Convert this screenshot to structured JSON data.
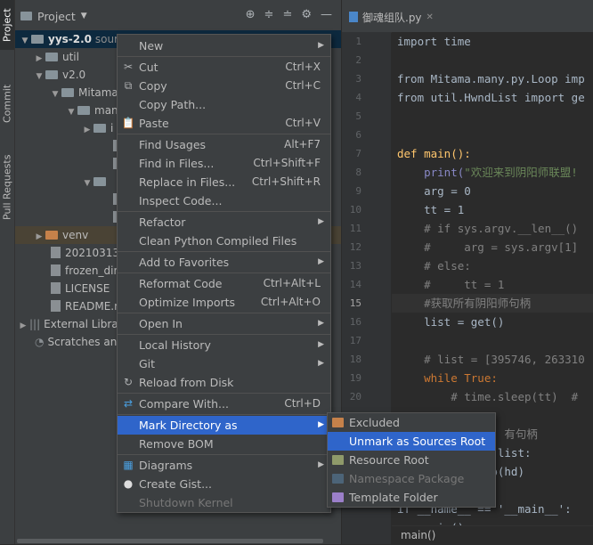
{
  "side_tabs": {
    "project": "Project",
    "commit": "Commit",
    "pull_requests": "Pull Requests"
  },
  "project_panel": {
    "title": "Project"
  },
  "tree": [
    {
      "label": "yys-2.0",
      "suffix": "sour",
      "arrow": "▼"
    },
    {
      "label": "util",
      "arrow": "▶"
    },
    {
      "label": "v2.0",
      "arrow": "▼"
    },
    {
      "label": "Mitama",
      "arrow": "▼"
    },
    {
      "label": "man",
      "arrow": "▼"
    },
    {
      "label": "i",
      "arrow": "▶"
    },
    {
      "label": "",
      "arrow": ""
    },
    {
      "label": "",
      "arrow": ""
    },
    {
      "label": "",
      "arrow": "▼"
    },
    {
      "label": "",
      "arrow": ""
    },
    {
      "label": "",
      "arrow": ""
    },
    {
      "label": "venv",
      "arrow": "▶"
    },
    {
      "label": "20210313",
      "arrow": ""
    },
    {
      "label": "frozen_dir",
      "arrow": ""
    },
    {
      "label": "LICENSE",
      "arrow": ""
    },
    {
      "label": "README.m",
      "arrow": ""
    },
    {
      "label": "External Librar",
      "arrow": "▶"
    },
    {
      "label": "Scratches and",
      "arrow": ""
    }
  ],
  "editor": {
    "tab_label": "御魂组队.py",
    "line_numbers": [
      "1",
      "2",
      "3",
      "4",
      "5",
      "6",
      "7",
      "8",
      "9",
      "10",
      "11",
      "12",
      "13",
      "14",
      "15",
      "16",
      "17",
      "18",
      "19",
      "20"
    ],
    "lines": {
      "l1": "import time",
      "l4": "from Mitama.many.py.Loop imp",
      "l5": "from util.HwndList import ge",
      "l8": "def main():",
      "l9a": "    print(",
      "l9b": "\"欢迎来到阴阳师联盟!",
      "l10": "    arg = 0",
      "l11": "    tt = 1",
      "l12": "    # if sys.argv.__len__()",
      "l13": "    #     arg = sys.argv[1]",
      "l14": "    # else:",
      "l15": "    #     tt = 1",
      "l16": "    #获取所有阴阳师句柄",
      "l17": "    list = get()",
      "l19": "    # list = [395746, 263310",
      "l20": "    while True:",
      "l21": "        # time.sleep(tt)  #",
      "l23": "                有句柄",
      "l24": "            in list:",
      "l25": "            oop(hd)",
      "l27": "if __name__ == '__main__':",
      "l28": "    main()"
    },
    "breadcrumb": "main()"
  },
  "context_menu": {
    "items": [
      {
        "label": "New",
        "shortcut": "",
        "icon": "",
        "submenu": true
      },
      {
        "label": "Cut",
        "shortcut": "Ctrl+X",
        "icon": "✂"
      },
      {
        "label": "Copy",
        "shortcut": "Ctrl+C",
        "icon": "⧉"
      },
      {
        "label": "Copy Path...",
        "shortcut": ""
      },
      {
        "label": "Paste",
        "shortcut": "Ctrl+V",
        "icon": "📋"
      },
      {
        "label": "Find Usages",
        "shortcut": "Alt+F7"
      },
      {
        "label": "Find in Files...",
        "shortcut": "Ctrl+Shift+F"
      },
      {
        "label": "Replace in Files...",
        "shortcut": "Ctrl+Shift+R"
      },
      {
        "label": "Inspect Code...",
        "shortcut": ""
      },
      {
        "label": "Refactor",
        "shortcut": "",
        "submenu": true
      },
      {
        "label": "Clean Python Compiled Files",
        "shortcut": ""
      },
      {
        "label": "Add to Favorites",
        "shortcut": "",
        "submenu": true
      },
      {
        "label": "Reformat Code",
        "shortcut": "Ctrl+Alt+L"
      },
      {
        "label": "Optimize Imports",
        "shortcut": "Ctrl+Alt+O"
      },
      {
        "label": "Open In",
        "shortcut": "",
        "submenu": true
      },
      {
        "label": "Local History",
        "shortcut": "",
        "submenu": true
      },
      {
        "label": "Git",
        "shortcut": "",
        "submenu": true
      },
      {
        "label": "Reload from Disk",
        "shortcut": "",
        "icon": "↻"
      },
      {
        "label": "Compare With...",
        "shortcut": "Ctrl+D",
        "icon": "⇄"
      },
      {
        "label": "Mark Directory as",
        "shortcut": "",
        "submenu": true
      },
      {
        "label": "Remove BOM",
        "shortcut": ""
      },
      {
        "label": "Diagrams",
        "shortcut": "",
        "submenu": true,
        "icon": "▦"
      },
      {
        "label": "Create Gist...",
        "shortcut": "",
        "icon": "●"
      },
      {
        "label": "Shutdown Kernel",
        "shortcut": ""
      }
    ]
  },
  "mark_submenu": {
    "items": [
      {
        "label": "Excluded",
        "color": "#c5814a"
      },
      {
        "label": "Unmark as Sources Root",
        "color": ""
      },
      {
        "label": "Resource Root",
        "color": "#8f9a6a"
      },
      {
        "label": "Namespace Package",
        "color": "#6a8fb0"
      },
      {
        "label": "Template Folder",
        "color": "#9b7fc9"
      }
    ]
  },
  "colors": {
    "selection": "#2f65ca",
    "background": "#2b2b2b",
    "panel": "#3c3f41"
  }
}
